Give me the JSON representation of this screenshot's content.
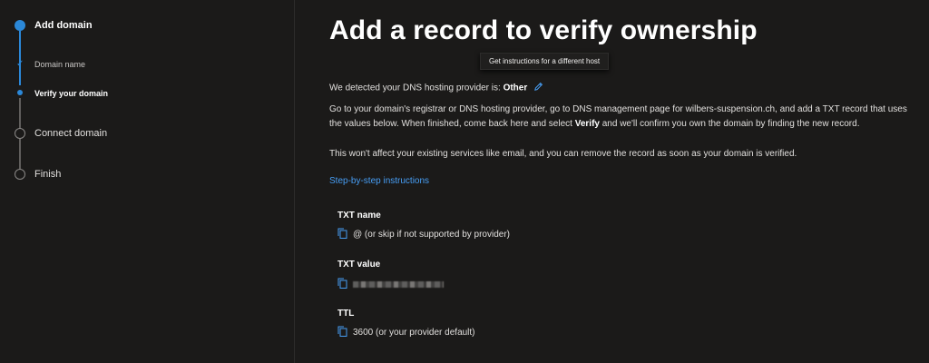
{
  "sidebar": {
    "steps": [
      {
        "label": "Add domain",
        "state": "active"
      },
      {
        "label": "Domain name",
        "state": "done",
        "sub": true
      },
      {
        "label": "Verify your domain",
        "state": "current",
        "sub": true
      },
      {
        "label": "Connect domain",
        "state": "pending"
      },
      {
        "label": "Finish",
        "state": "pending"
      }
    ]
  },
  "main": {
    "title": "Add a record to verify ownership",
    "tooltip": "Get instructions for a different host",
    "detect_prefix": "We detected your DNS hosting provider is: ",
    "provider": "Other",
    "para1_a": "Go to your domain's registrar or DNS hosting provider, go to DNS management page for wilbers-suspension.ch, and add a TXT record that uses the values below. When finished, come back here and select ",
    "para1_bold": "Verify",
    "para1_b": " and we'll confirm you own the domain by finding the new record.",
    "para2": "This won't affect your existing services like email, and you can remove the record as soon as your domain is verified.",
    "link": "Step-by-step instructions",
    "records": {
      "txt_name_label": "TXT name",
      "txt_name_value": "@ (or skip if not supported by provider)",
      "txt_value_label": "TXT value",
      "ttl_label": "TTL",
      "ttl_value": "3600 (or your provider default)"
    }
  },
  "colors": {
    "accent": "#2b88d8",
    "link": "#479ef5",
    "background": "#1b1a19"
  },
  "icons": {
    "edit": "pencil-icon",
    "copy": "copy-icon"
  }
}
